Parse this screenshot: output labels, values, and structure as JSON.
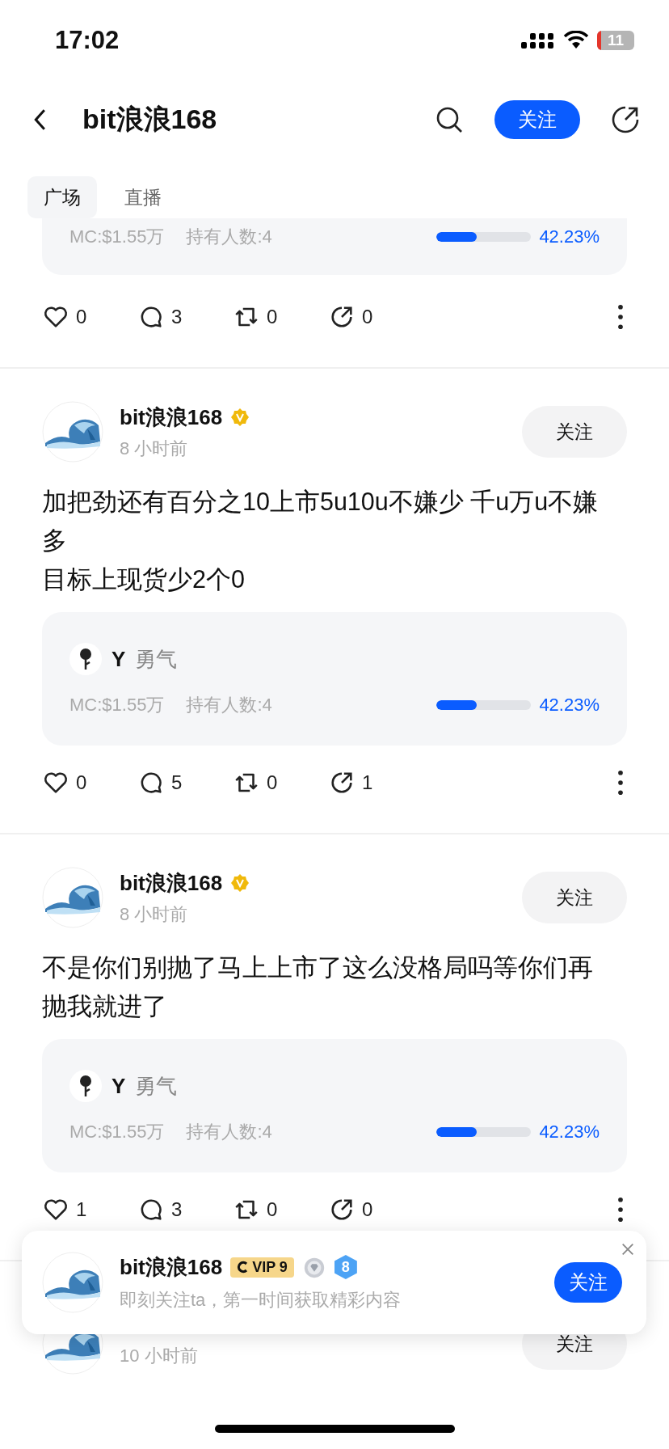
{
  "status_bar": {
    "time": "17:02",
    "battery": "11"
  },
  "header": {
    "title": "bit浪浪168",
    "follow_button": "关注"
  },
  "tabs": [
    {
      "label": "广场",
      "selected": true
    },
    {
      "label": "直播",
      "selected": false
    }
  ],
  "posts": [
    {
      "kind": "partial_top",
      "token": {
        "mc": "MC:$1.55万",
        "holders": "持有人数:4",
        "level": 0.4223,
        "percent": "42.23%"
      },
      "actions": {
        "likes": "0",
        "comments": "3",
        "reposts": "0",
        "shares": "0"
      }
    },
    {
      "kind": "full",
      "author": "bit浪浪168",
      "verified": true,
      "time": "8 小时前",
      "follow": "关注",
      "text": [
        "加把劲还有百分之10上市5u10u不嫌少 千u万u不嫌多",
        "目标上现货少2个0"
      ],
      "token": {
        "symbol": "Y",
        "name": "勇气",
        "mc": "MC:$1.55万",
        "holders": "持有人数:4",
        "level": 0.4223,
        "percent": "42.23%"
      },
      "actions": {
        "likes": "0",
        "comments": "5",
        "reposts": "0",
        "shares": "1"
      }
    },
    {
      "kind": "full",
      "author": "bit浪浪168",
      "verified": true,
      "time": "8 小时前",
      "follow": "关注",
      "text": [
        "不是你们别抛了马上上市了这么没格局吗等你们再抛我就进了"
      ],
      "token": {
        "symbol": "Y",
        "name": "勇气",
        "mc": "MC:$1.55万",
        "holders": "持有人数:4",
        "level": 0.4223,
        "percent": "42.23%"
      },
      "actions": {
        "likes": "1",
        "comments": "3",
        "reposts": "0",
        "shares": "0"
      }
    },
    {
      "kind": "partial_bottom",
      "time": "10 小时前",
      "follow": "关注"
    }
  ],
  "follow_popup": {
    "name": "bit浪浪168",
    "vip": "VIP 9",
    "level_badge": "8",
    "subtitle": "即刻关注ta，第一时间获取精彩内容",
    "follow_button": "关注"
  }
}
